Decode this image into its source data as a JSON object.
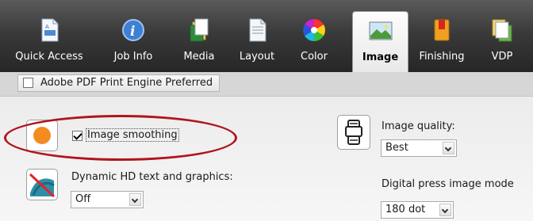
{
  "tabs": [
    {
      "label": "Quick Access",
      "icon": "quick-access-icon"
    },
    {
      "label": "Job Info",
      "icon": "info-icon"
    },
    {
      "label": "Media",
      "icon": "media-icon"
    },
    {
      "label": "Layout",
      "icon": "layout-icon"
    },
    {
      "label": "Color",
      "icon": "color-wheel-icon"
    },
    {
      "label": "Image",
      "icon": "image-icon",
      "active": true
    },
    {
      "label": "Finishing",
      "icon": "finishing-icon"
    },
    {
      "label": "VDP",
      "icon": "vdp-icon"
    }
  ],
  "subbar": {
    "engine_label": "Adobe PDF Print Engine Preferred",
    "engine_checked": false
  },
  "image_smoothing": {
    "label": "Image smoothing",
    "checked": true,
    "icon": "orange-circle-icon",
    "highlighted": true,
    "highlight_color": "#b0151c"
  },
  "dynamic_hd": {
    "label": "Dynamic HD text and graphics:",
    "value": "Off",
    "icon": "dynamic-hd-disabled-icon"
  },
  "image_quality": {
    "label": "Image quality:",
    "value": "Best",
    "icon": "printer-quality-icon"
  },
  "digital_press": {
    "label": "Digital press image mode",
    "value": "180 dot"
  },
  "colors": {
    "tabbar": "#2e2e2e",
    "active_tab": "#f4f4f4",
    "orange": "#f28c1e",
    "highlight": "#b0151c"
  }
}
